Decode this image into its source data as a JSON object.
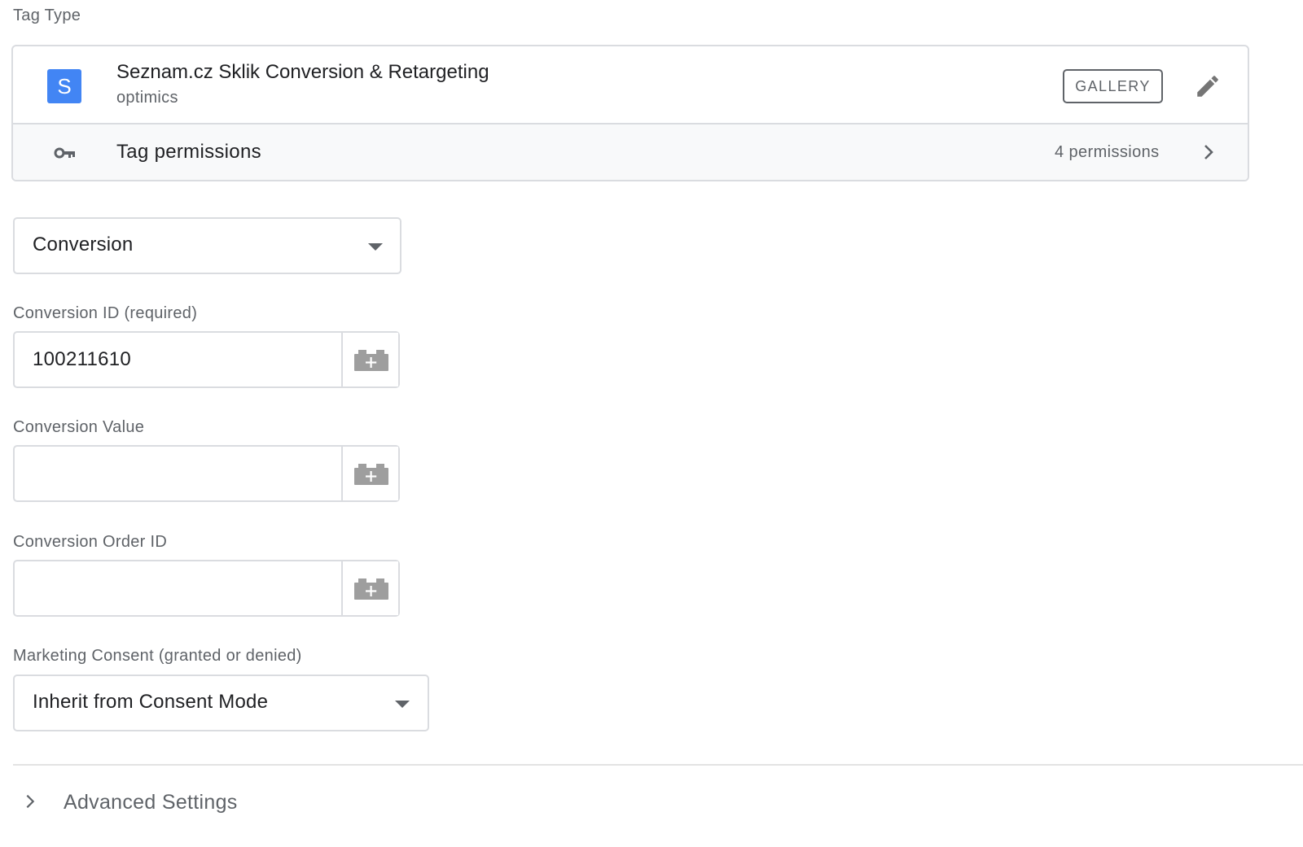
{
  "tag_type": {
    "section_label": "Tag Type",
    "logo_letter": "S",
    "title": "Seznam.cz Sklik Conversion & Retargeting",
    "subtitle": "optimics",
    "gallery_label": "GALLERY",
    "permissions_label": "Tag permissions",
    "permissions_count": "4 permissions",
    "logo_color": "#4285f4"
  },
  "type_select": {
    "value": "Conversion"
  },
  "fields": [
    {
      "label": "Conversion ID (required)",
      "value": "100211610"
    },
    {
      "label": "Conversion Value",
      "value": ""
    },
    {
      "label": "Conversion Order ID",
      "value": ""
    }
  ],
  "consent": {
    "label": "Marketing Consent (granted or denied)",
    "value": "Inherit from Consent Mode"
  },
  "advanced": {
    "label": "Advanced Settings"
  },
  "icons": {
    "edit": "pencil-icon",
    "permissions": "key-icon",
    "permissions_arrow": "chevron-right-icon",
    "variable": "variable-brick-icon",
    "dropdown": "caret-down-icon",
    "advanced_expand": "chevron-right-icon"
  }
}
